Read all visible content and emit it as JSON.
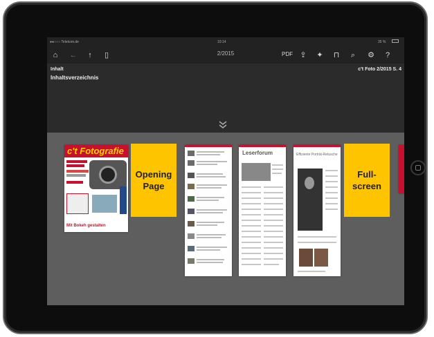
{
  "status_bar": {
    "carrier": "●●○○○ Telekom.de",
    "time": "10:14",
    "battery": "35 %"
  },
  "toolbar": {
    "title": "2/2015",
    "pdf_label": "PDF"
  },
  "header": {
    "section": "Inhalt",
    "issue_ref": "c't Foto 2/2015 S. 4",
    "subtitle": "Inhaltsverzeichnis"
  },
  "cover": {
    "masthead": "c't Fotografie",
    "footer_text": "Mit Bokeh gestalten"
  },
  "callouts": {
    "opening": "Opening Page",
    "fullscreen": "Full-screen"
  },
  "pages": {
    "leserforum_title": "Leserforum",
    "retusche_title": "Effiziente Porträt-Retusche"
  }
}
